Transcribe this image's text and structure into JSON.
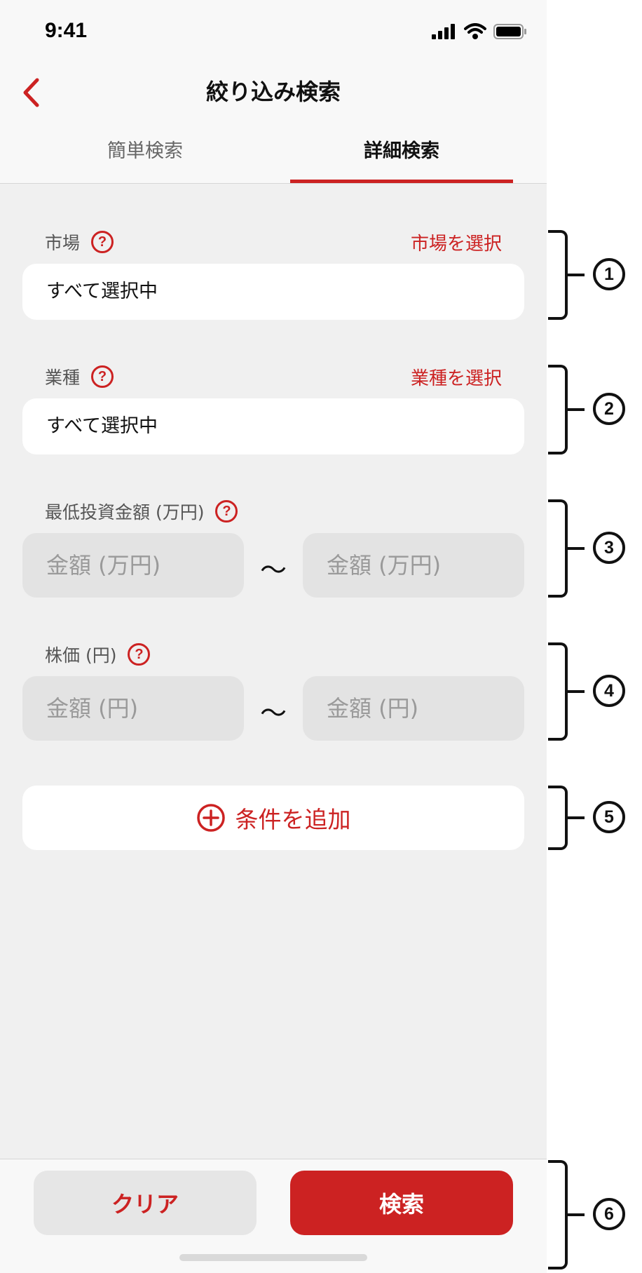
{
  "status_bar": {
    "time": "9:41"
  },
  "header": {
    "title": "絞り込み検索",
    "tabs": [
      {
        "label": "簡単検索",
        "active": false
      },
      {
        "label": "詳細検索",
        "active": true
      }
    ]
  },
  "filters": {
    "market": {
      "label": "市場",
      "help": "?",
      "link": "市場を選択",
      "value": "すべて選択中"
    },
    "industry": {
      "label": "業種",
      "help": "?",
      "link": "業種を選択",
      "value": "すべて選択中"
    },
    "min_investment": {
      "label": "最低投資金額 (万円)",
      "help": "?",
      "min_placeholder": "金額 (万円)",
      "max_placeholder": "金額 (万円)",
      "separator": "〜"
    },
    "stock_price": {
      "label": "株価 (円)",
      "help": "?",
      "min_placeholder": "金額 (円)",
      "max_placeholder": "金額 (円)",
      "separator": "〜"
    }
  },
  "add_condition": {
    "label": "条件を追加"
  },
  "footer": {
    "clear_label": "クリア",
    "search_label": "検索"
  },
  "annotations": [
    "1",
    "2",
    "3",
    "4",
    "5",
    "6"
  ],
  "colors": {
    "accent": "#cc2222",
    "background": "#f0f0f0",
    "field_grey": "#e3e3e3"
  }
}
